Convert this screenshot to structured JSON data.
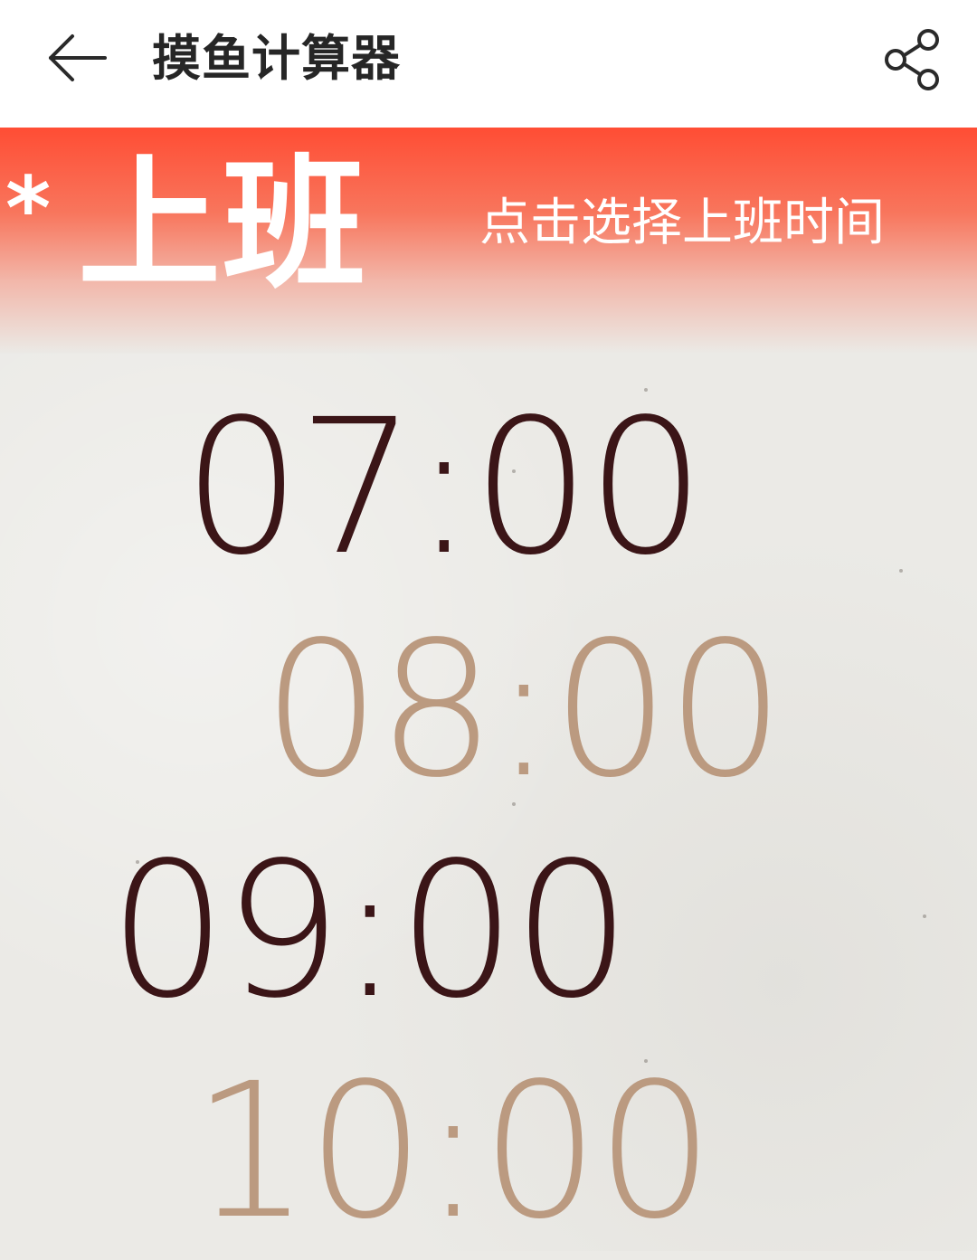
{
  "header": {
    "title": "摸鱼计算器"
  },
  "banner": {
    "star": "*",
    "title": "上班",
    "hint": "点击选择上班时间"
  },
  "time_options": [
    {
      "label": "07:00"
    },
    {
      "label": "08:00"
    },
    {
      "label": "09:00"
    },
    {
      "label": "10:00"
    }
  ],
  "colors": {
    "banner_red": "#ff4d34",
    "time_dark": "#3b1517",
    "time_light": "#bb9a80",
    "background": "#ebeae6"
  },
  "icons": {
    "back": "arrow-left-icon",
    "share": "share-icon"
  }
}
